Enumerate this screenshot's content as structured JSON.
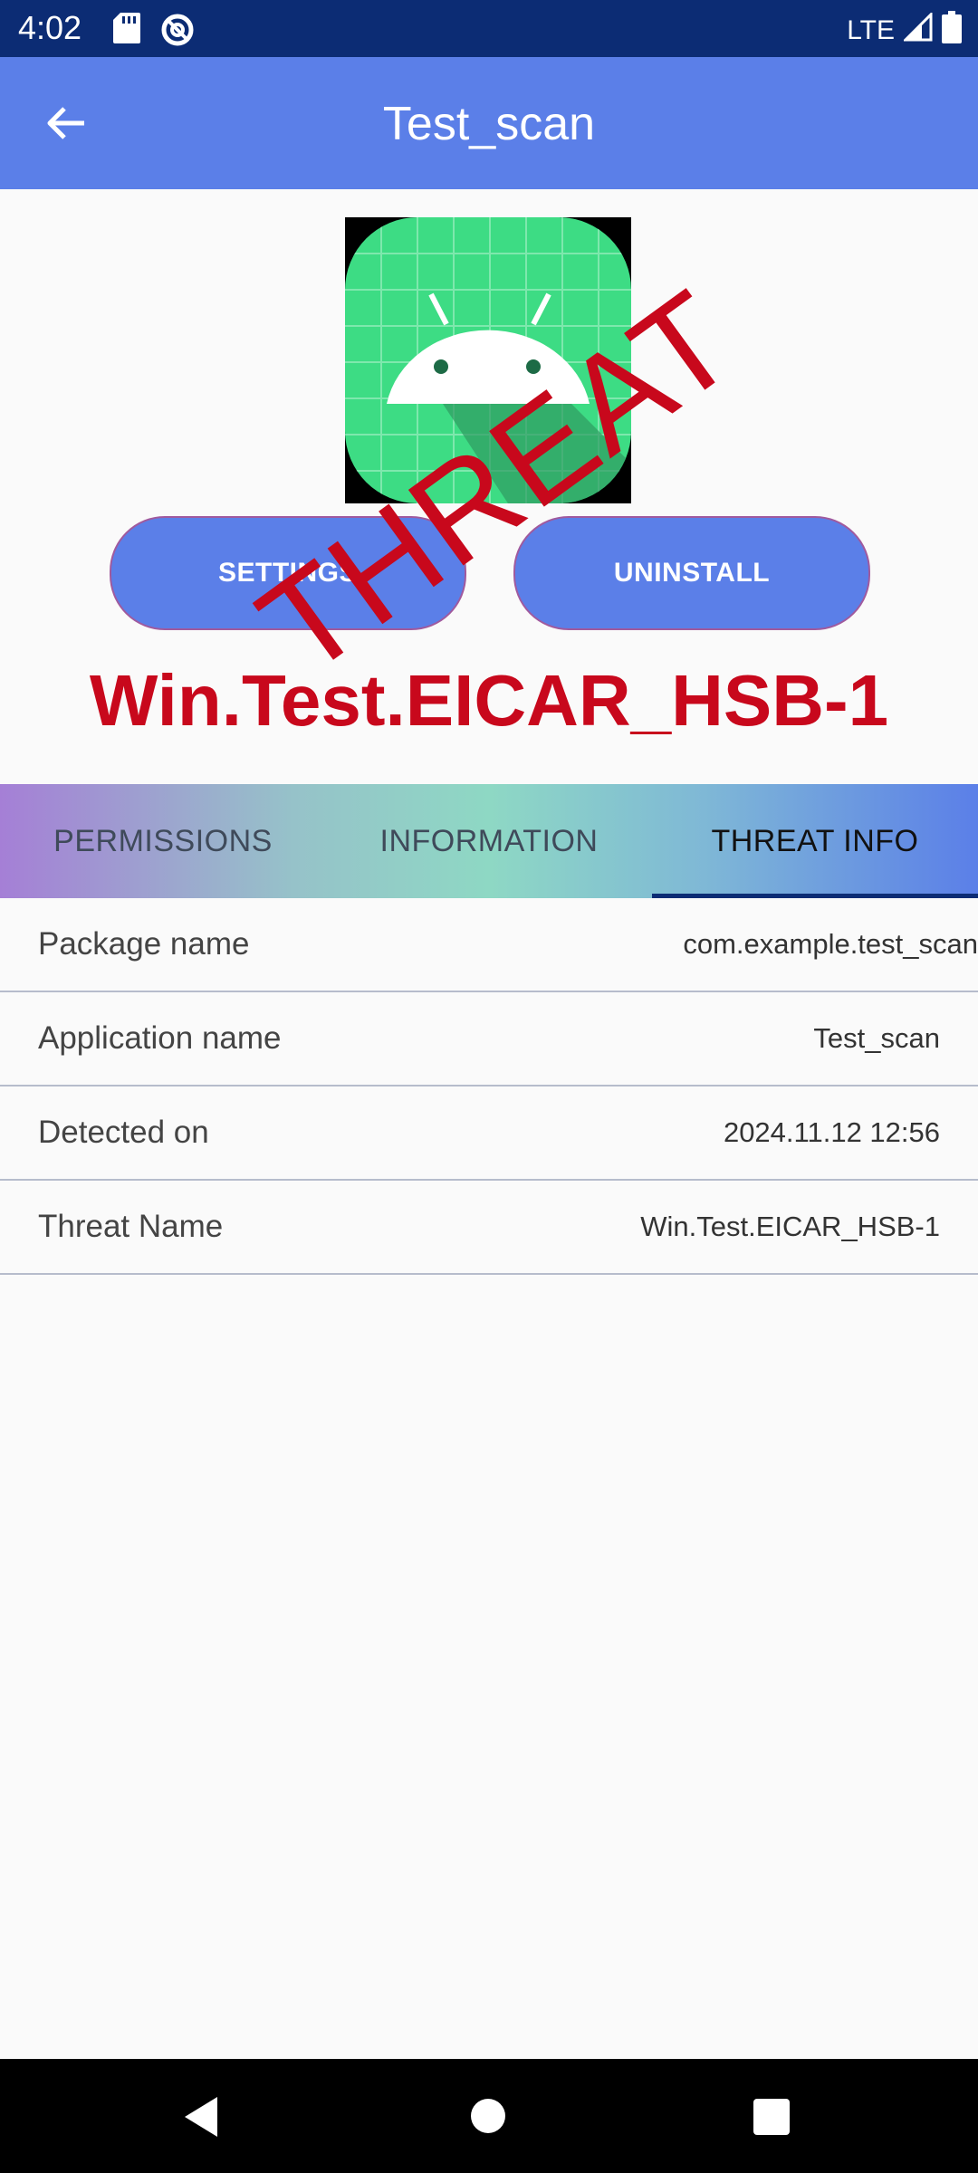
{
  "status_bar": {
    "time": "4:02",
    "network": "LTE",
    "icons": [
      "sd-card-icon",
      "at-sign-icon",
      "signal-icon",
      "battery-icon"
    ]
  },
  "app_bar": {
    "title": "Test_scan",
    "back_icon": "arrow-left-icon"
  },
  "header": {
    "settings_label": "SETTINGS",
    "uninstall_label": "UNINSTALL",
    "threat_stamp": "THREAT",
    "threat_name": "Win.Test.EICAR_HSB-1",
    "threat_color": "#c8081c"
  },
  "tabs": [
    {
      "label": "PERMISSIONS",
      "active": false
    },
    {
      "label": "INFORMATION",
      "active": false
    },
    {
      "label": "THREAT INFO",
      "active": true
    }
  ],
  "rows": [
    {
      "label": "Package name",
      "value": "com.example.test_scan"
    },
    {
      "label": "Application name",
      "value": "Test_scan"
    },
    {
      "label": "Detected on",
      "value": "2024.11.12 12:56"
    },
    {
      "label": "Threat Name",
      "value": "Win.Test.EICAR_HSB-1"
    }
  ],
  "colors": {
    "status_bar": "#0c2c74",
    "app_bar": "#5b7fe8",
    "button": "#5b7fe8"
  }
}
